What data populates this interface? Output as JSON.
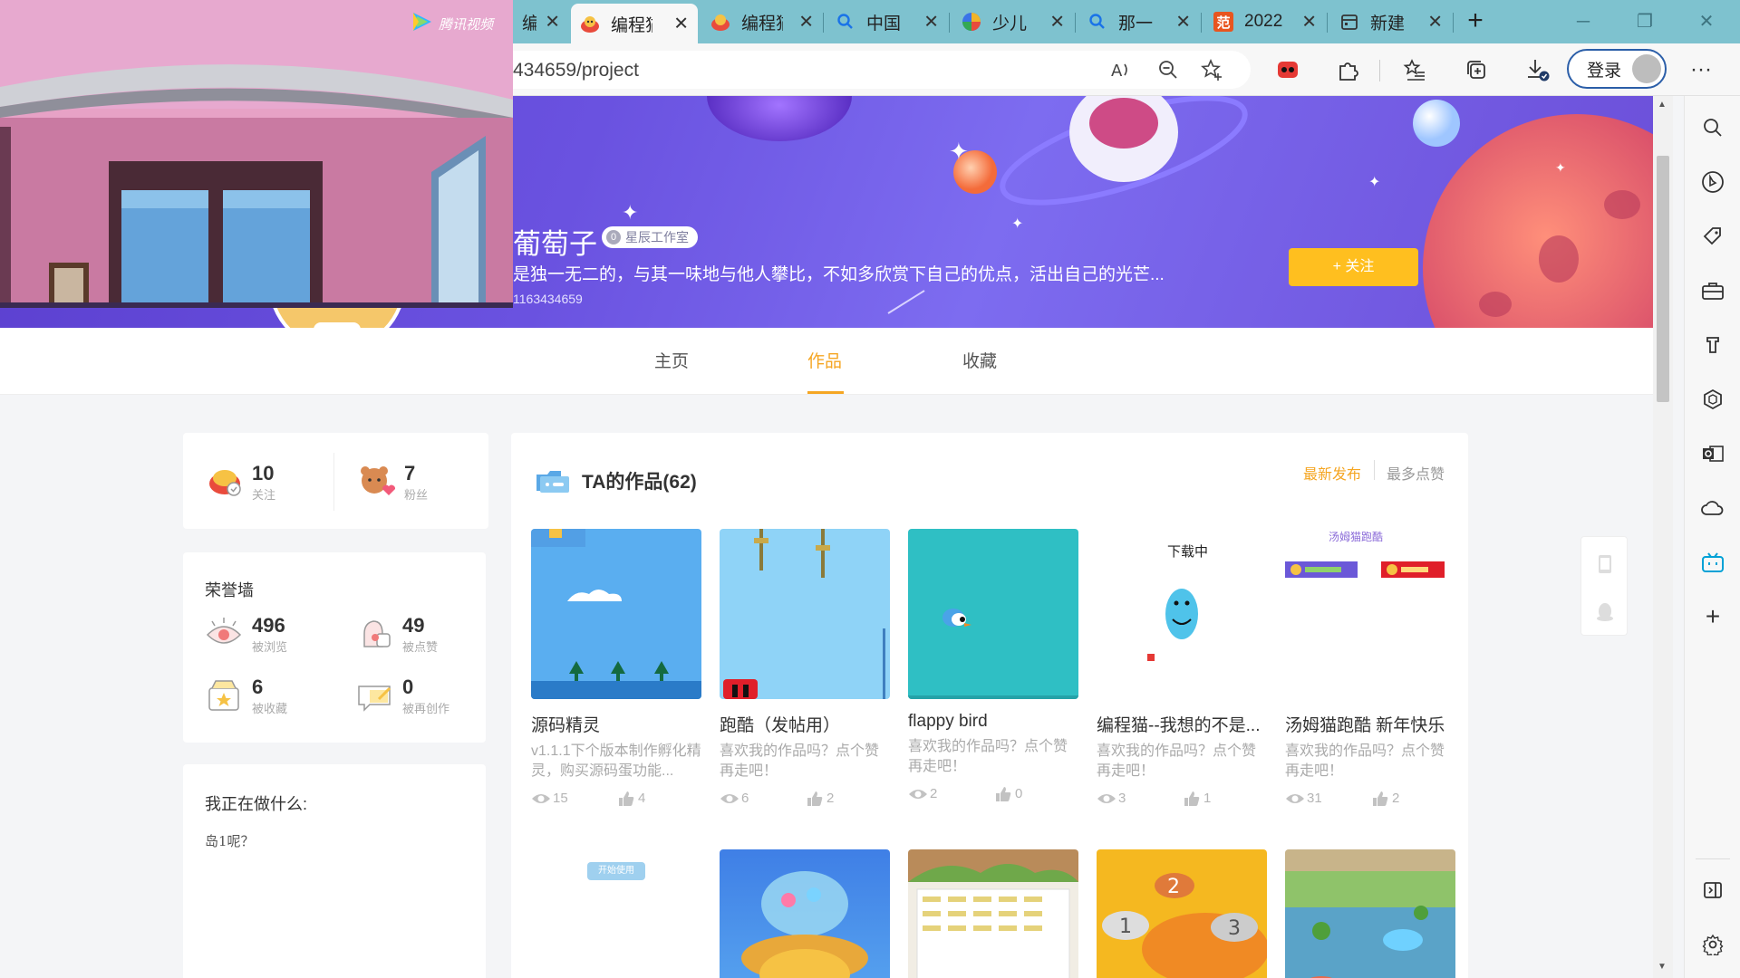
{
  "tabs": [
    {
      "label": "编程猫",
      "active": false
    },
    {
      "label": "编程猫",
      "active": true
    },
    {
      "label": "编程猫",
      "active": false
    },
    {
      "label": "中国",
      "active": false
    },
    {
      "label": "少儿",
      "active": false
    },
    {
      "label": "那一",
      "active": false
    },
    {
      "label": "2022",
      "active": false
    },
    {
      "label": "新建",
      "active": false
    }
  ],
  "address": {
    "url": "434659/project"
  },
  "toolbar": {
    "login_label": "登录"
  },
  "video_brand": "腾讯视频",
  "profile": {
    "name": "葡萄子",
    "studio_badge": "星辰工作室",
    "motto": "是独一无二的，与其一味地与他人攀比，不如多欣赏下自己的优点，活出自己的光芒...",
    "id": "1163434659",
    "follow_label": "+ 关注"
  },
  "nav": {
    "home": "主页",
    "works": "作品",
    "favorites": "收藏"
  },
  "social": {
    "following_count": "10",
    "following_label": "关注",
    "fans_count": "7",
    "fans_label": "粉丝"
  },
  "honor": {
    "title": "荣誉墙",
    "views": "496",
    "views_label": "被浏览",
    "likes": "49",
    "likes_label": "被点赞",
    "collects": "6",
    "collects_label": "被收藏",
    "recreate": "0",
    "recreate_label": "被再创作"
  },
  "doing": {
    "title": "我正在做什么:",
    "text": "岛1呢？"
  },
  "works_panel": {
    "title": "TA的作品(62)",
    "sort_latest": "最新发布",
    "sort_likes": "最多点赞"
  },
  "works": [
    {
      "title": "源码精灵",
      "desc": "v1.1.1下个版本制作孵化精灵，购买源码蛋功能...",
      "views": "15",
      "likes": "4"
    },
    {
      "title": "跑酷（发帖用）",
      "desc": "喜欢我的作品吗？点个赞再走吧！",
      "views": "6",
      "likes": "2"
    },
    {
      "title": "flappy bird",
      "desc": "喜欢我的作品吗？点个赞再走吧！",
      "views": "2",
      "likes": "0"
    },
    {
      "title": "编程猫--我想的不是...",
      "desc": "喜欢我的作品吗？点个赞再走吧！",
      "views": "3",
      "likes": "1"
    },
    {
      "title": "汤姆猫跑酷 新年快乐",
      "desc": "喜欢我的作品吗？点个赞再走吧！",
      "views": "31",
      "likes": "2"
    }
  ],
  "thumb_texts": {
    "downloading": "下载中",
    "tom_title": "汤姆猫跑酷",
    "start_use": "开始使用"
  },
  "colors": {
    "accent": "#f5a623",
    "follow": "#ffbf1f",
    "tabbar": "#7ec2cf",
    "banner": "#6a52e0"
  }
}
